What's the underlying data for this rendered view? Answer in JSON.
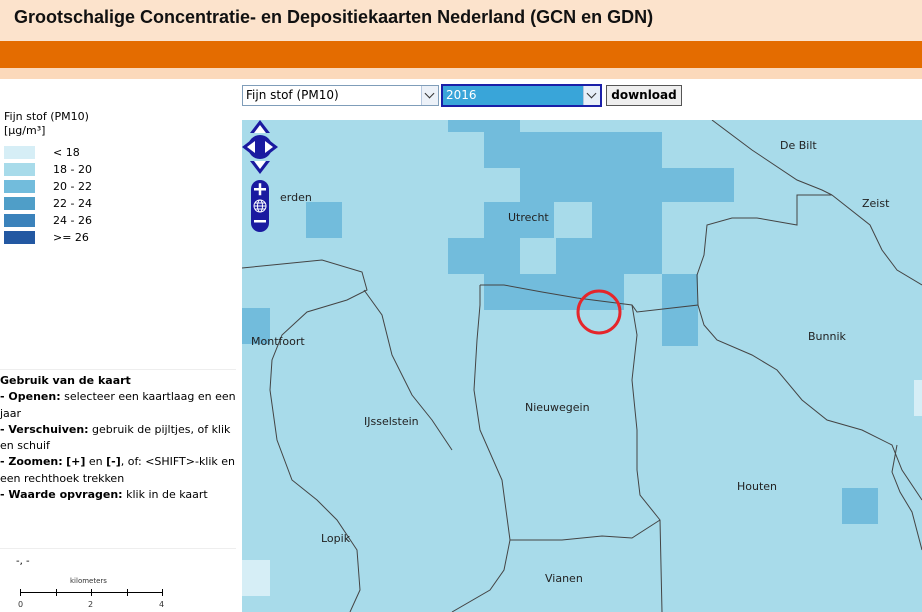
{
  "header": {
    "title": "Grootschalige Concentratie- en Depositiekaarten Nederland (GCN en GDN)"
  },
  "controls": {
    "layer_select": {
      "value": "Fijn stof (PM10)"
    },
    "year_select": {
      "value": "2016"
    },
    "download_label": "download"
  },
  "legend": {
    "title": "Fijn stof (PM10)",
    "unit": "[µg/m³]",
    "classes": [
      {
        "label": "< 18",
        "color": "#d6eef6"
      },
      {
        "label": "18 - 20",
        "color": "#a8dbea"
      },
      {
        "label": "20 - 22",
        "color": "#72bcdc"
      },
      {
        "label": "22 - 24",
        "color": "#4f9ec8"
      },
      {
        "label": "24 - 26",
        "color": "#3b82bb"
      },
      {
        "label": ">= 26",
        "color": "#2358a2"
      }
    ]
  },
  "instructions": {
    "heading": "Gebruik van de kaart",
    "open_label": "- Openen:",
    "open_text": " selecteer een kaartlaag en een jaar",
    "move_label": "- Verschuiven:",
    "move_text": " gebruik de pijltjes, of klik en schuif",
    "zoom_label": "- Zoomen:",
    "zoom_plus": "[+]",
    "zoom_en": " en ",
    "zoom_minus": "[-]",
    "zoom_text": ", of: <SHIFT>-klik en een rechthoek trekken",
    "query_label": "- Waarde opvragen:",
    "query_text": " klik in de kaart"
  },
  "coordinates_readout": "-, -",
  "scalebar": {
    "unit": "kilometers",
    "labels": [
      "0",
      "2",
      "4"
    ]
  },
  "map": {
    "places": [
      {
        "name": "De Bilt"
      },
      {
        "name": "Zeist"
      },
      {
        "name": "Utrecht"
      },
      {
        "name": "erden"
      },
      {
        "name": "Montfoort"
      },
      {
        "name": "Bunnik"
      },
      {
        "name": "IJsselstein"
      },
      {
        "name": "Nieuwegein"
      },
      {
        "name": "Houten"
      },
      {
        "name": "Lopik"
      },
      {
        "name": "Vianen"
      }
    ],
    "colors": {
      "background": "#a8dbea",
      "boundary": "#444444",
      "marker": "#e5262b"
    }
  }
}
